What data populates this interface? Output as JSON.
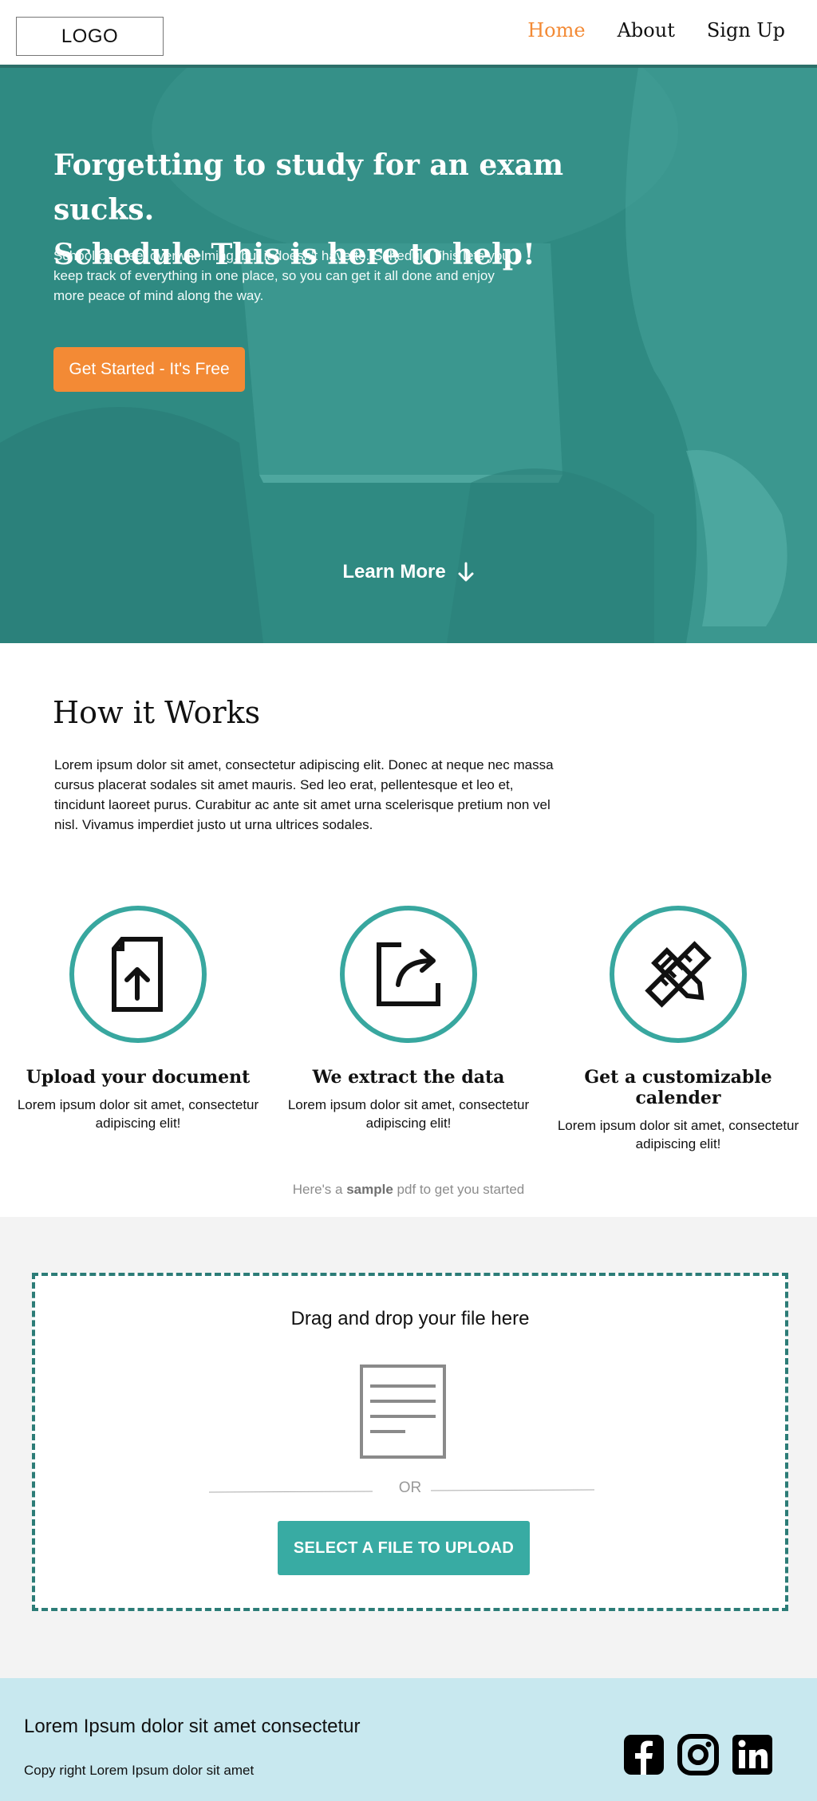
{
  "nav": {
    "logo": "LOGO",
    "links": [
      {
        "label": "Home",
        "active": true
      },
      {
        "label": "About",
        "active": false
      },
      {
        "label": "Sign Up",
        "active": false
      }
    ]
  },
  "hero": {
    "title_line1": "Forgetting to study for an exam sucks.",
    "title_line2": "Schedule This is here to help!",
    "description": "School can feel overwhelming, but it doesn't have to. Schedule This lets you keep track of everything in one place, so you can get it all done and enjoy more peace of mind along the way.",
    "cta_label": "Get Started - It's Free",
    "learn_more": "Learn More"
  },
  "how": {
    "title": "How it Works",
    "description": "Lorem ipsum dolor sit amet, consectetur adipiscing elit. Donec at neque nec massa cursus placerat sodales sit amet mauris. Sed leo erat, pellentesque et leo et, tincidunt laoreet purus. Curabitur ac ante sit amet urna scelerisque pretium non vel nisl. Vivamus imperdiet justo ut urna ultrices sodales.",
    "features": [
      {
        "title": "Upload your document",
        "text": "Lorem ipsum dolor sit amet, consectetur adipiscing elit!",
        "icon": "upload-document-icon"
      },
      {
        "title": "We extract the  data",
        "text": "Lorem ipsum dolor sit amet, consectetur adipiscing elit!",
        "icon": "share-export-icon"
      },
      {
        "title": "Get a customizable calender",
        "text": "Lorem ipsum dolor sit amet, consectetur adipiscing elit!",
        "icon": "pencil-ruler-icon"
      }
    ],
    "sample_prefix": "Here's a ",
    "sample_bold": "sample",
    "sample_suffix": " pdf to get you started"
  },
  "upload": {
    "title": "Drag and drop your file here",
    "or": "OR",
    "button": "SELECT A FILE TO UPLOAD"
  },
  "footer": {
    "title": "Lorem Ipsum dolor sit amet consectetur",
    "copyright": "Copy right Lorem Ipsum dolor sit amet",
    "socials": [
      "facebook-icon",
      "instagram-icon",
      "linkedin-icon"
    ]
  },
  "colors": {
    "accent": "#f38a35",
    "teal": "#38aba3",
    "hero": "#328c84",
    "footer": "#c8e8ef"
  }
}
